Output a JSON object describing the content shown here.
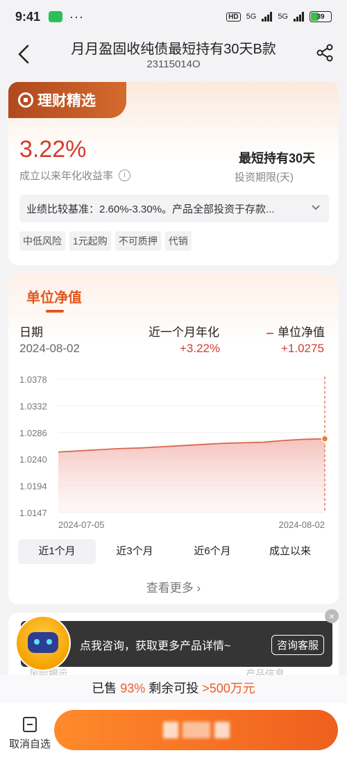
{
  "status_bar": {
    "time": "9:41",
    "more": "···",
    "hd": "HD",
    "net1": "5G",
    "net2": "5G",
    "battery": "39"
  },
  "header": {
    "title": "月月盈固收纯债最短持有30天B款",
    "code": "23115014O"
  },
  "product": {
    "brand": "理财精选",
    "rate": "3.22%",
    "rate_label": "成立以来年化收益率",
    "period": "最短持有30天",
    "period_label": "投资期限(天)",
    "benchmark": "业绩比较基准：2.60%-3.30%。产品全部投资于存款...",
    "tags": [
      "中低风险",
      "1元起购",
      "不可质押",
      "代销"
    ]
  },
  "nav": {
    "title": "单位净值",
    "date_label": "日期",
    "date_value": "2024-08-02",
    "annual_label": "近一个月年化",
    "annual_value": "+3.22%",
    "nav_label": "单位净值",
    "nav_value": "+1.0275",
    "tabs": [
      "近1个月",
      "近3个月",
      "近6个月",
      "成立以来"
    ],
    "more": "查看更多"
  },
  "chart_data": {
    "type": "area",
    "title": "",
    "ylabel": "",
    "xlabel": "",
    "y_ticks": [
      "1.0378",
      "1.0332",
      "1.0286",
      "1.0240",
      "1.0194",
      "1.0147"
    ],
    "ylim": [
      1.0147,
      1.0378
    ],
    "x_tick_labels": [
      "2024-07-05",
      "2024-08-02"
    ],
    "x": [
      "2024-07-05",
      "2024-07-08",
      "2024-07-10",
      "2024-07-12",
      "2024-07-15",
      "2024-07-17",
      "2024-07-19",
      "2024-07-22",
      "2024-07-24",
      "2024-07-26",
      "2024-07-29",
      "2024-07-31",
      "2024-08-01",
      "2024-08-02"
    ],
    "series": [
      {
        "values": [
          1.0252,
          1.0254,
          1.0256,
          1.0258,
          1.0259,
          1.0261,
          1.0263,
          1.0265,
          1.0267,
          1.0268,
          1.0269,
          1.0272,
          1.0274,
          1.0275
        ]
      }
    ],
    "line_color": "#d9664f",
    "fill_color": "#f3b7b0",
    "marker_color": "#f07b2e"
  },
  "consult": {
    "text": "点我咨询，获取更多产品详情~",
    "button": "咨询客服",
    "close": "×"
  },
  "sold": {
    "prefix": "已售",
    "percent": "93%",
    "mid": "剩余可投",
    "amount": ">500万元"
  },
  "bottom": {
    "fav_label": "取消自选"
  },
  "partially_hidden_labels": {
    "left": "风险揭示",
    "right": "产品信息"
  },
  "colors": {
    "accent": "#ef5b26",
    "rate": "#d43b2c",
    "brand_bg": "#c0562a"
  }
}
